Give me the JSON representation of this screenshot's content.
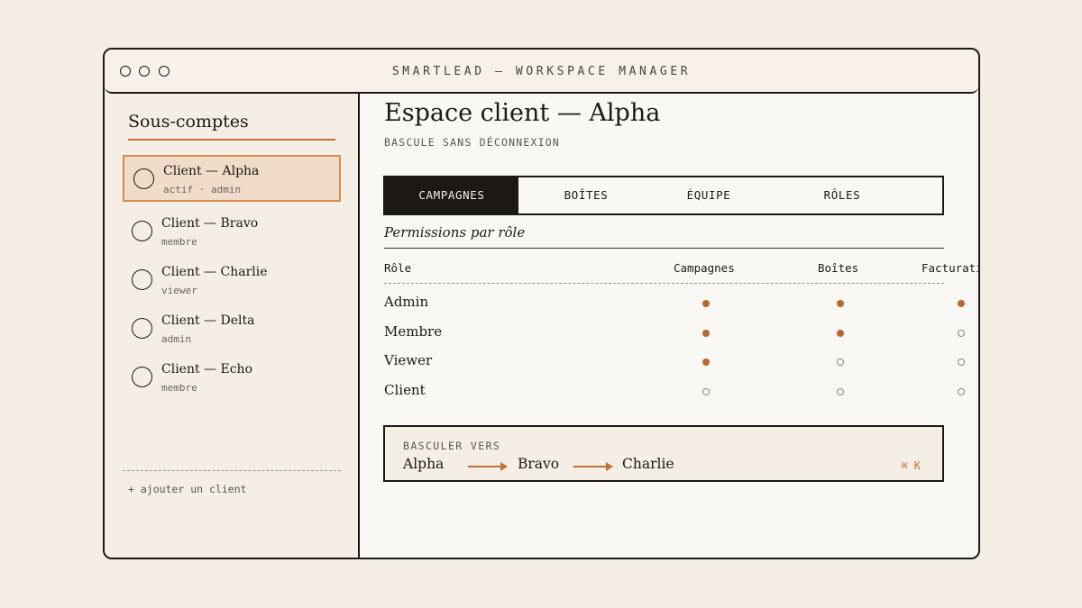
{
  "window": {
    "title": "SMARTLEAD — WORKSPACE MANAGER"
  },
  "sidebar": {
    "title": "Sous-comptes",
    "clients": [
      {
        "name": "Client — Alpha",
        "role": "actif · admin",
        "active": true
      },
      {
        "name": "Client — Bravo",
        "role": "membre",
        "active": false
      },
      {
        "name": "Client — Charlie",
        "role": "viewer",
        "active": false
      },
      {
        "name": "Client — Delta",
        "role": "admin",
        "active": false
      },
      {
        "name": "Client — Echo",
        "role": "membre",
        "active": false
      }
    ],
    "add_label": "+ ajouter un client"
  },
  "main": {
    "title": "Espace client — Alpha",
    "subtitle": "BASCULE SANS DÉCONNEXION",
    "tabs": [
      {
        "label": "CAMPAGNES",
        "active": true
      },
      {
        "label": "BOÎTES",
        "active": false
      },
      {
        "label": "ÉQUIPE",
        "active": false
      },
      {
        "label": "RÔLES",
        "active": false
      }
    ],
    "permissions": {
      "title": "Permissions par rôle",
      "headers": [
        "Rôle",
        "Campagnes",
        "Boîtes",
        "Facturation"
      ],
      "rows": [
        {
          "role": "Admin",
          "values": [
            true,
            true,
            true
          ]
        },
        {
          "role": "Membre",
          "values": [
            true,
            true,
            false
          ]
        },
        {
          "role": "Viewer",
          "values": [
            true,
            false,
            false
          ]
        },
        {
          "role": "Client",
          "values": [
            false,
            false,
            false
          ]
        }
      ]
    },
    "switcher": {
      "label": "BASCULER VERS",
      "items": [
        "Alpha",
        "Bravo",
        "Charlie"
      ],
      "shortcut": "⌘ K"
    }
  },
  "colors": {
    "accent": "#c2703a",
    "ink": "#1b1815",
    "background": "#f5eee5",
    "active_fill": "#f1dcc9"
  },
  "icons": {
    "window_controls": [
      "window-dot-icon",
      "window-dot-icon",
      "window-dot-icon"
    ],
    "client_selector": "radio-circle-icon",
    "permission_granted": "filled-dot-icon",
    "permission_denied": "hollow-dot-icon",
    "switch_arrow": "arrow-right-icon"
  }
}
